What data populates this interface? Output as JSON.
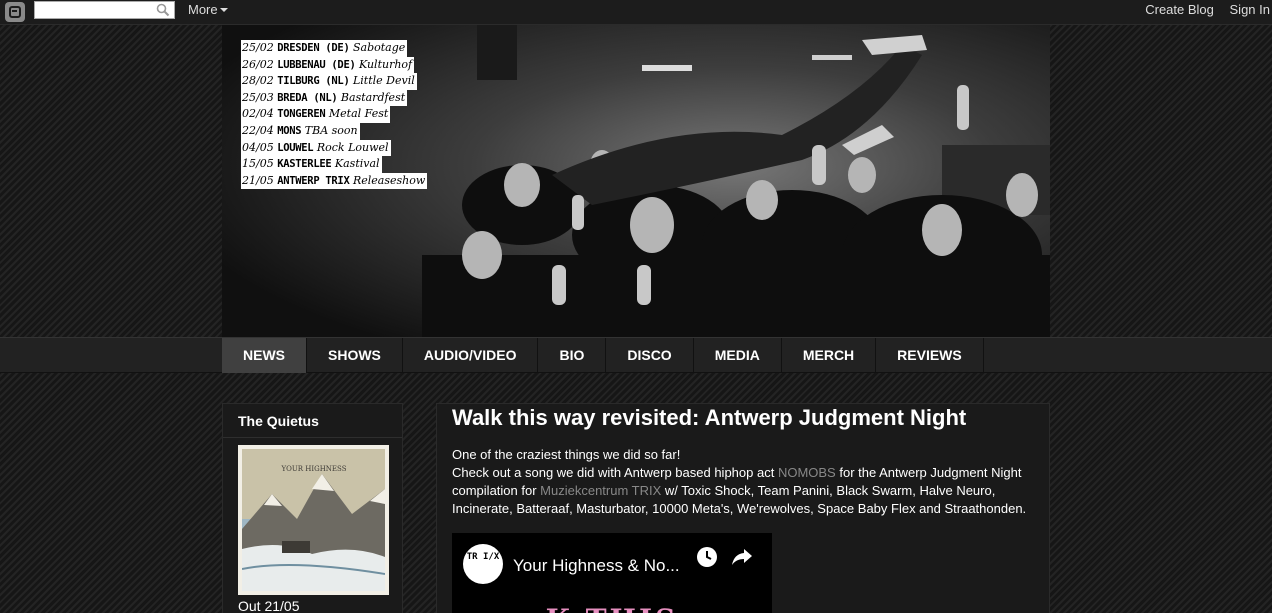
{
  "navbar": {
    "search_placeholder": "",
    "more_label": "More",
    "create_blog": "Create Blog",
    "sign_in": "Sign In"
  },
  "tour": [
    {
      "date": "25/02",
      "city": "DRESDEN (DE)",
      "venue": "Sabotage"
    },
    {
      "date": "26/02",
      "city": "LUBBENAU (DE)",
      "venue": "Kulturhof"
    },
    {
      "date": "28/02",
      "city": "TILBURG (NL)",
      "venue": "Little Devil"
    },
    {
      "date": "25/03",
      "city": "BREDA (NL)",
      "venue": "Bastardfest"
    },
    {
      "date": "02/04",
      "city": "TONGEREN",
      "venue": "Metal Fest"
    },
    {
      "date": "22/04",
      "city": "MONS",
      "venue": "TBA soon"
    },
    {
      "date": "04/05",
      "city": "LOUWEL",
      "venue": "Rock Louwel"
    },
    {
      "date": "15/05",
      "city": "KASTERLEE",
      "venue": "Kastival"
    },
    {
      "date": "21/05",
      "city": "ANTWERP TRIX",
      "venue": "Releaseshow"
    }
  ],
  "mainnav": [
    "NEWS",
    "SHOWS",
    "AUDIO/VIDEO",
    "BIO",
    "DISCO",
    "MEDIA",
    "MERCH",
    "REVIEWS"
  ],
  "sidebar": {
    "title": "The Quietus",
    "caption": "Out 21/05",
    "album_text": "YOUR HIGHNESS"
  },
  "post": {
    "title": "Walk this way revisited: Antwerp Judgment Night",
    "line1": "One of the craziest things we did so far!",
    "p2_a": "Check out a song we did with Antwerp based hiphop act ",
    "link1": "NOMOBS",
    "p2_b": " for the Antwerp Judgment Night compilation for ",
    "link2": "Muziekcentrum TRIX",
    "p2_c": " w/ Toxic Shock, Team Panini, Black Swarm, Halve Neuro, Incinerate, Batteraaf, Masturbator, 10000 Meta's, We'rewolves, Space Baby Flex and Straathonden.",
    "video": {
      "logo": "TR I/X",
      "title": "Your Highness & No...",
      "art_text": "K THIS"
    }
  },
  "colors": {
    "link": "#888888",
    "active_tab": "#404040",
    "art_pink": "#e68fbf"
  }
}
